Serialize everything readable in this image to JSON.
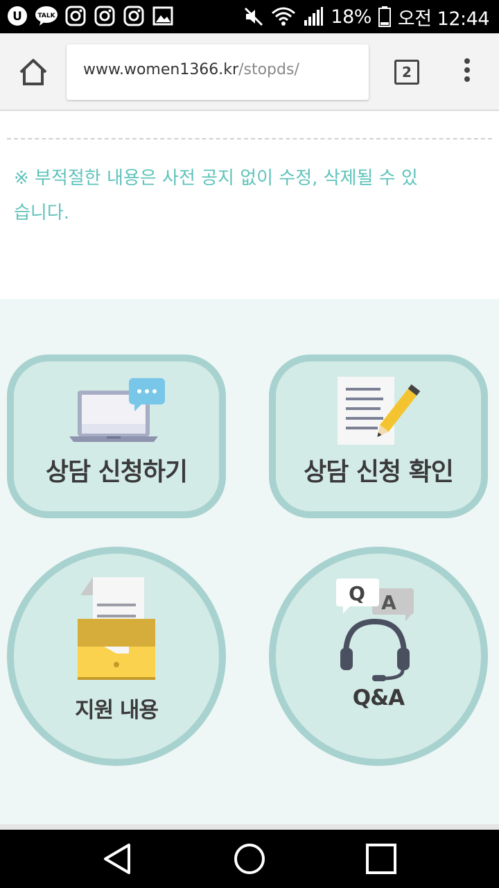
{
  "status_bar": {
    "app_icons": [
      "u-plus-icon",
      "kakaotalk-icon",
      "instagram-icon",
      "instagram-icon",
      "instagram-icon",
      "gallery-icon"
    ],
    "kakao_badge": "TALK",
    "battery": "18%",
    "time": "오전 12:44"
  },
  "browser": {
    "url_host": "www.women1366.kr",
    "url_path": "/stopds/",
    "tab_count": "2"
  },
  "notice": "※ 부적절한 내용은 사전 공지 없이 수정, 삭제될 수 있습니다.",
  "menu": {
    "apply": "상담 신청하기",
    "check": "상담 신청 확인",
    "support": "지원 내용",
    "qa": "Q&A",
    "qa_q": "Q",
    "qa_a": "A"
  },
  "colors": {
    "accent_text": "#5fc3bb",
    "card_bg": "#d3ebe7",
    "card_border": "#a8d2cf",
    "menu_bg": "#eef7f5"
  }
}
